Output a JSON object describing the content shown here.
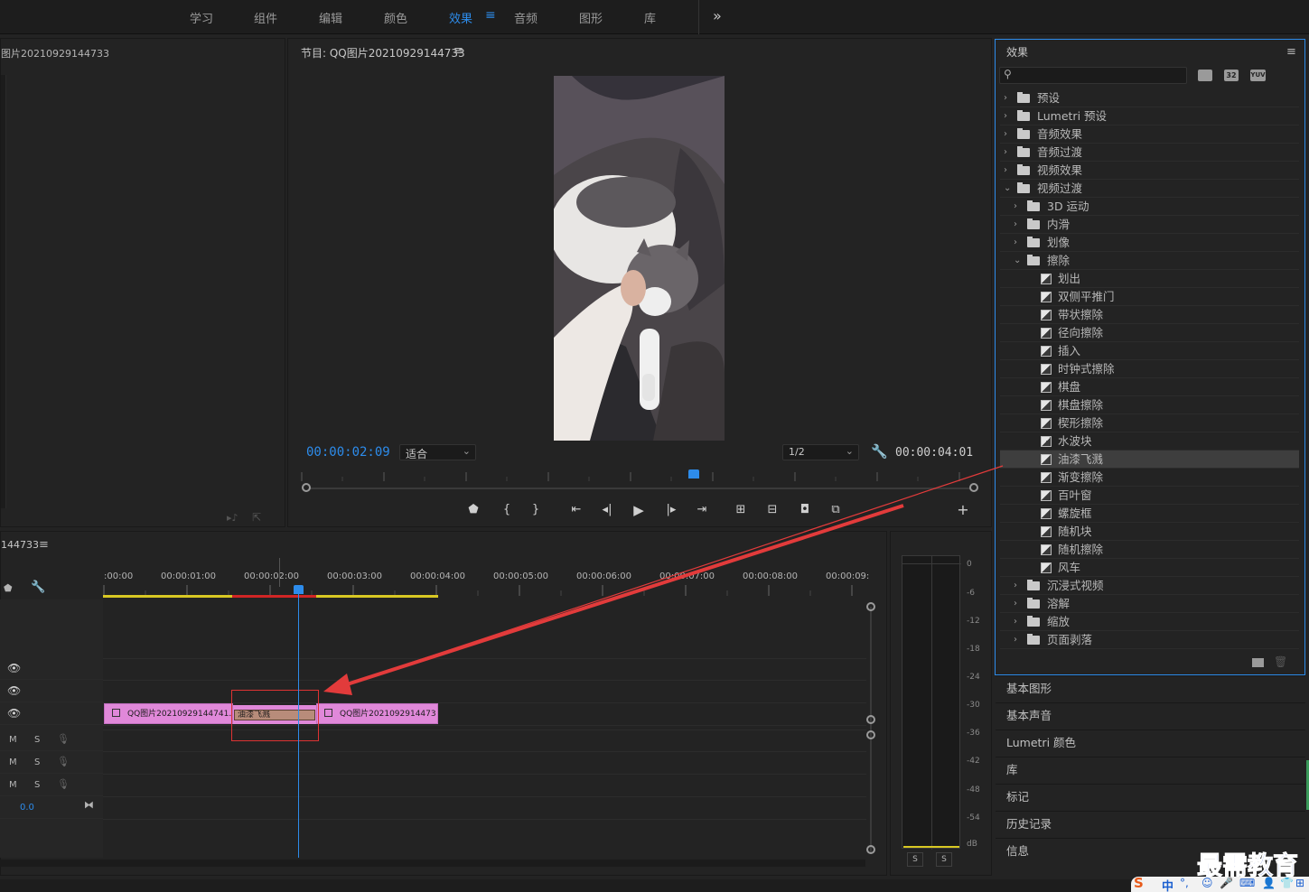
{
  "workspaces": [
    "学习",
    "组件",
    "编辑",
    "颜色",
    "效果",
    "音频",
    "图形",
    "库"
  ],
  "active_workspace": "效果",
  "overflow_label": "»",
  "source_panel": {
    "title": "图片20210929144733"
  },
  "program_monitor": {
    "title": "节目: QQ图片20210929144733",
    "timecode": "00:00:02:09",
    "fit_label": "适合",
    "resolution_label": "1/2",
    "duration": "00:00:04:01"
  },
  "timeline": {
    "title": "144733",
    "ruler_labels": [
      ":00:00",
      "00:00:01:00",
      "00:00:02:00",
      "00:00:03:00",
      "00:00:04:00",
      "00:00:05:00",
      "00:00:06:00",
      "00:00:07:00",
      "00:00:08:00",
      "00:00:09:"
    ],
    "clip_a": "QQ图片20210929144741.",
    "clip_b": "QQ图片2021092914473",
    "transition": "油漆飞溅",
    "audio_labels": {
      "m": "M",
      "s": "S"
    },
    "volume_value": "0.0"
  },
  "meter": {
    "scale": [
      "0",
      "-6",
      "-12",
      "-18",
      "-24",
      "-30",
      "-36",
      "-42",
      "-48",
      "-54",
      "dB"
    ],
    "solo": "S"
  },
  "effects_panel": {
    "title": "效果",
    "search_placeholder": "",
    "badges": [
      "32",
      "YUV"
    ],
    "items": [
      {
        "label": "预设",
        "level": 0,
        "type": "preset",
        "open": false
      },
      {
        "label": "Lumetri 预设",
        "level": 0,
        "type": "preset",
        "open": false
      },
      {
        "label": "音频效果",
        "level": 0,
        "type": "folder",
        "open": false
      },
      {
        "label": "音频过渡",
        "level": 0,
        "type": "folder",
        "open": false
      },
      {
        "label": "视频效果",
        "level": 0,
        "type": "folder",
        "open": false
      },
      {
        "label": "视频过渡",
        "level": 0,
        "type": "folder",
        "open": true
      },
      {
        "label": "3D 运动",
        "level": 1,
        "type": "folder",
        "open": false
      },
      {
        "label": "内滑",
        "level": 1,
        "type": "folder",
        "open": false
      },
      {
        "label": "划像",
        "level": 1,
        "type": "folder",
        "open": false
      },
      {
        "label": "擦除",
        "level": 1,
        "type": "folder",
        "open": true
      },
      {
        "label": "划出",
        "level": 2,
        "type": "fx"
      },
      {
        "label": "双侧平推门",
        "level": 2,
        "type": "fx"
      },
      {
        "label": "带状擦除",
        "level": 2,
        "type": "fx"
      },
      {
        "label": "径向擦除",
        "level": 2,
        "type": "fx"
      },
      {
        "label": "插入",
        "level": 2,
        "type": "fx"
      },
      {
        "label": "时钟式擦除",
        "level": 2,
        "type": "fx"
      },
      {
        "label": "棋盘",
        "level": 2,
        "type": "fx"
      },
      {
        "label": "棋盘擦除",
        "level": 2,
        "type": "fx"
      },
      {
        "label": "楔形擦除",
        "level": 2,
        "type": "fx"
      },
      {
        "label": "水波块",
        "level": 2,
        "type": "fx"
      },
      {
        "label": "油漆飞溅",
        "level": 2,
        "type": "fx",
        "selected": true
      },
      {
        "label": "渐变擦除",
        "level": 2,
        "type": "fx"
      },
      {
        "label": "百叶窗",
        "level": 2,
        "type": "fx"
      },
      {
        "label": "螺旋框",
        "level": 2,
        "type": "fx"
      },
      {
        "label": "随机块",
        "level": 2,
        "type": "fx"
      },
      {
        "label": "随机擦除",
        "level": 2,
        "type": "fx"
      },
      {
        "label": "风车",
        "level": 2,
        "type": "fx"
      },
      {
        "label": "沉浸式视频",
        "level": 1,
        "type": "folder",
        "open": false
      },
      {
        "label": "溶解",
        "level": 1,
        "type": "folder",
        "open": false
      },
      {
        "label": "缩放",
        "level": 1,
        "type": "folder",
        "open": false
      },
      {
        "label": "页面剥落",
        "level": 1,
        "type": "folder",
        "open": false
      }
    ]
  },
  "side_sections": [
    "基本图形",
    "基本声音",
    "Lumetri 颜色",
    "库",
    "标记",
    "历史记录",
    "信息"
  ],
  "watermark": "最需教育",
  "tray_text": "中"
}
